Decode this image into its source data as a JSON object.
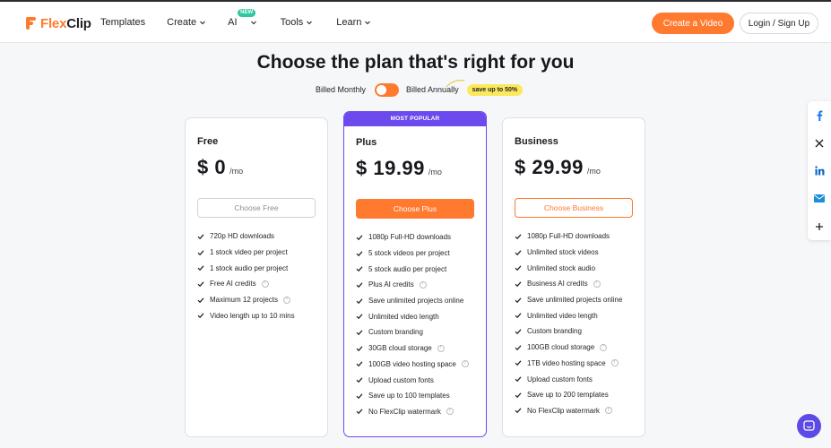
{
  "header": {
    "logo": {
      "part1": "Flex",
      "part2": "Clip"
    },
    "nav": [
      {
        "label": "Templates",
        "dropdown": false
      },
      {
        "label": "Create",
        "dropdown": true
      },
      {
        "label": "AI",
        "dropdown": true,
        "badge": "NEW"
      },
      {
        "label": "Tools",
        "dropdown": true
      },
      {
        "label": "Learn",
        "dropdown": true
      }
    ],
    "create_button": "Create a Video",
    "login_button": "Login / Sign Up"
  },
  "pricing": {
    "title": "Choose the plan that's right for you",
    "billing": {
      "monthly_label": "Billed Monthly",
      "annually_label": "Billed Annually",
      "save_tag": "save up to 50%",
      "annual_selected": true
    },
    "plans": [
      {
        "name": "Free",
        "price": "$ 0",
        "period": "/mo",
        "cta": "Choose Free",
        "features": [
          {
            "text": "720p HD downloads",
            "info": false
          },
          {
            "text": "1 stock video per project",
            "info": false
          },
          {
            "text": "1 stock audio per project",
            "info": false
          },
          {
            "text": "Free AI credits",
            "info": true
          },
          {
            "text": "Maximum 12 projects",
            "info": true
          },
          {
            "text": "Video length up to 10 mins",
            "info": false
          }
        ]
      },
      {
        "name": "Plus",
        "badge": "MOST POPULAR",
        "price": "$ 19.99",
        "period": "/mo",
        "cta": "Choose Plus",
        "features": [
          {
            "text": "1080p Full-HD downloads",
            "info": false
          },
          {
            "text": "5 stock videos per project",
            "info": false
          },
          {
            "text": "5 stock audio per project",
            "info": false
          },
          {
            "text": "Plus AI credits",
            "info": true
          },
          {
            "text": "Save unlimited projects online",
            "info": false
          },
          {
            "text": "Unlimited video length",
            "info": false
          },
          {
            "text": "Custom branding",
            "info": false
          },
          {
            "text": "30GB cloud storage",
            "info": true
          },
          {
            "text": "100GB video hosting space",
            "info": true
          },
          {
            "text": "Upload custom fonts",
            "info": false
          },
          {
            "text": "Save up to 100 templates",
            "info": false
          },
          {
            "text": "No FlexClip watermark",
            "info": true
          }
        ]
      },
      {
        "name": "Business",
        "price": "$ 29.99",
        "period": "/mo",
        "cta": "Choose Business",
        "features": [
          {
            "text": "1080p Full-HD downloads",
            "info": false
          },
          {
            "text": "Unlimited stock videos",
            "info": false
          },
          {
            "text": "Unlimited stock audio",
            "info": false
          },
          {
            "text": "Business AI credits",
            "info": true
          },
          {
            "text": "Save unlimited projects online",
            "info": false
          },
          {
            "text": "Unlimited video length",
            "info": false
          },
          {
            "text": "Custom branding",
            "info": false
          },
          {
            "text": "100GB cloud storage",
            "info": true
          },
          {
            "text": "1TB video hosting space",
            "info": true
          },
          {
            "text": "Upload custom fonts",
            "info": false
          },
          {
            "text": "Save up to 200 templates",
            "info": false
          },
          {
            "text": "No FlexClip watermark",
            "info": true
          }
        ]
      }
    ]
  },
  "share_bar": [
    "facebook-icon",
    "x-icon",
    "linkedin-icon",
    "email-icon",
    "plus-icon"
  ],
  "chat_widget": "chat-bubble-icon",
  "colors": {
    "brand_orange": "#ff7a2f",
    "popular_purple": "#6d4aed",
    "save_yellow": "#fbe85d",
    "chat_purple": "#5b4ae6"
  }
}
